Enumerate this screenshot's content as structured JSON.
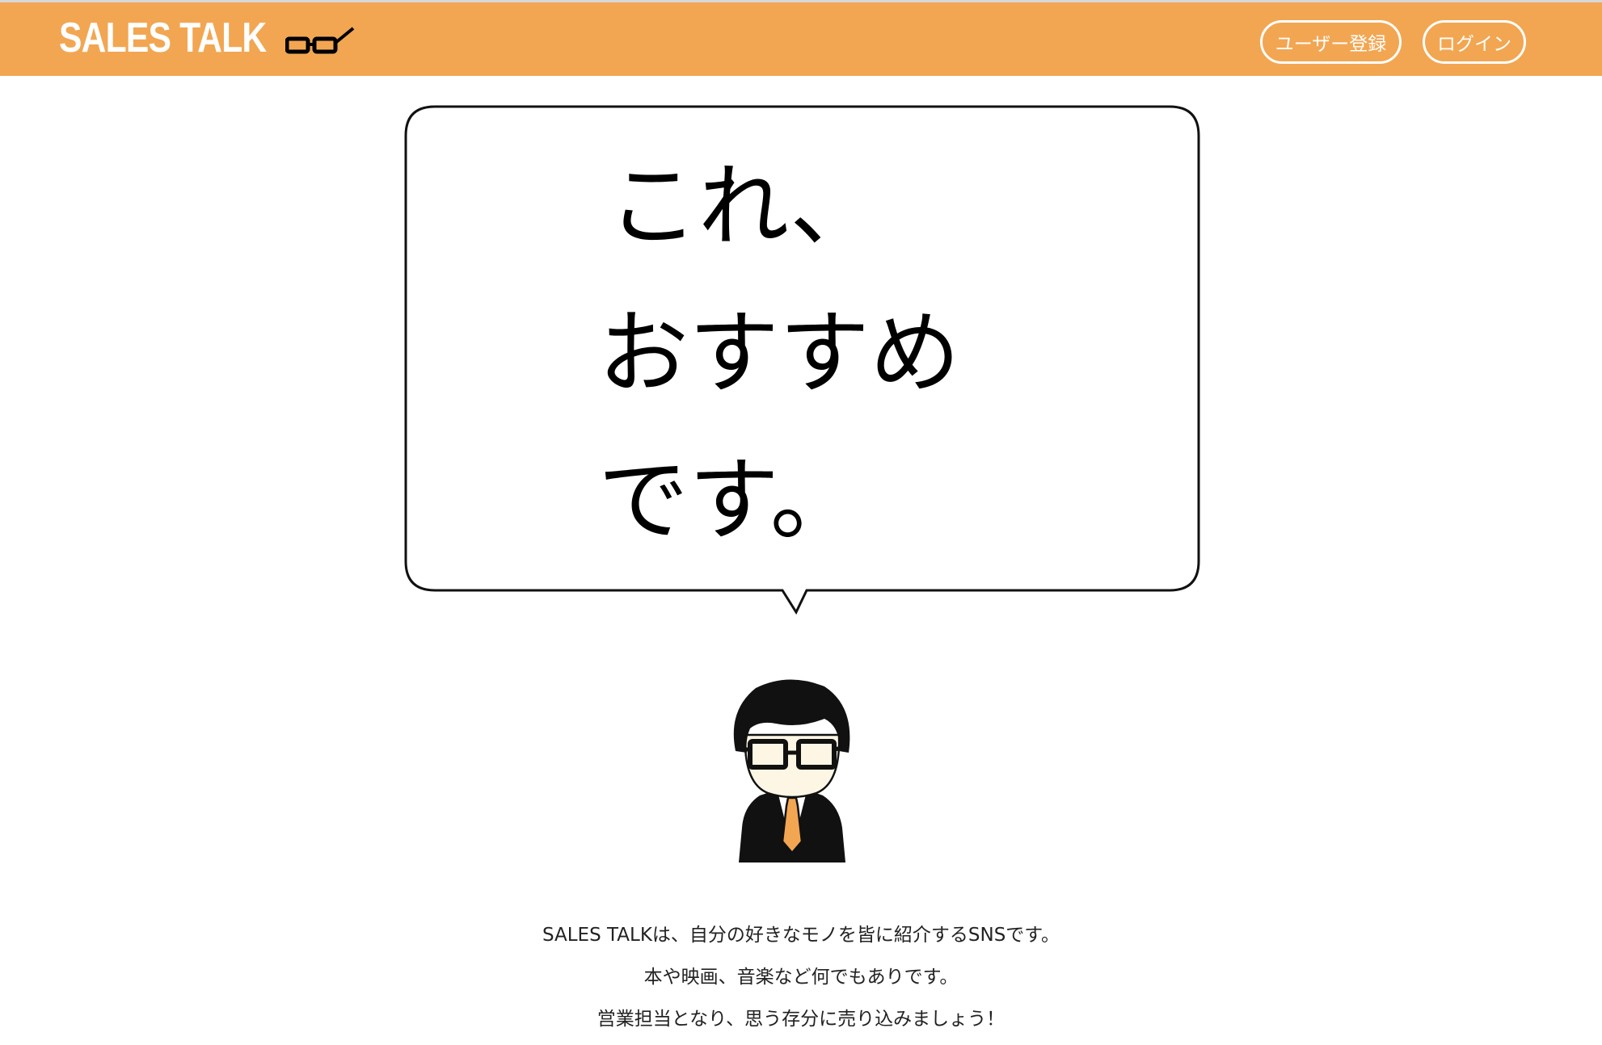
{
  "header": {
    "logo_text": "SALES TALK",
    "logo_icon": "glasses-icon",
    "register_button": "ユーザー登録",
    "login_button": "ログイン"
  },
  "hero": {
    "bubble_lines": [
      "これ、",
      "おすすめ",
      "です。"
    ],
    "mascot": "salesman-mascot"
  },
  "description": {
    "lines": [
      "SALES TALKは、自分の好きなモノを皆に紹介するSNSです。",
      "本や映画、音楽など何でもありです。",
      "営業担当となり、思う存分に売り込みましょう！"
    ]
  },
  "colors": {
    "header_bg": "#f2a652",
    "tie": "#f2a652",
    "text": "#222222"
  }
}
